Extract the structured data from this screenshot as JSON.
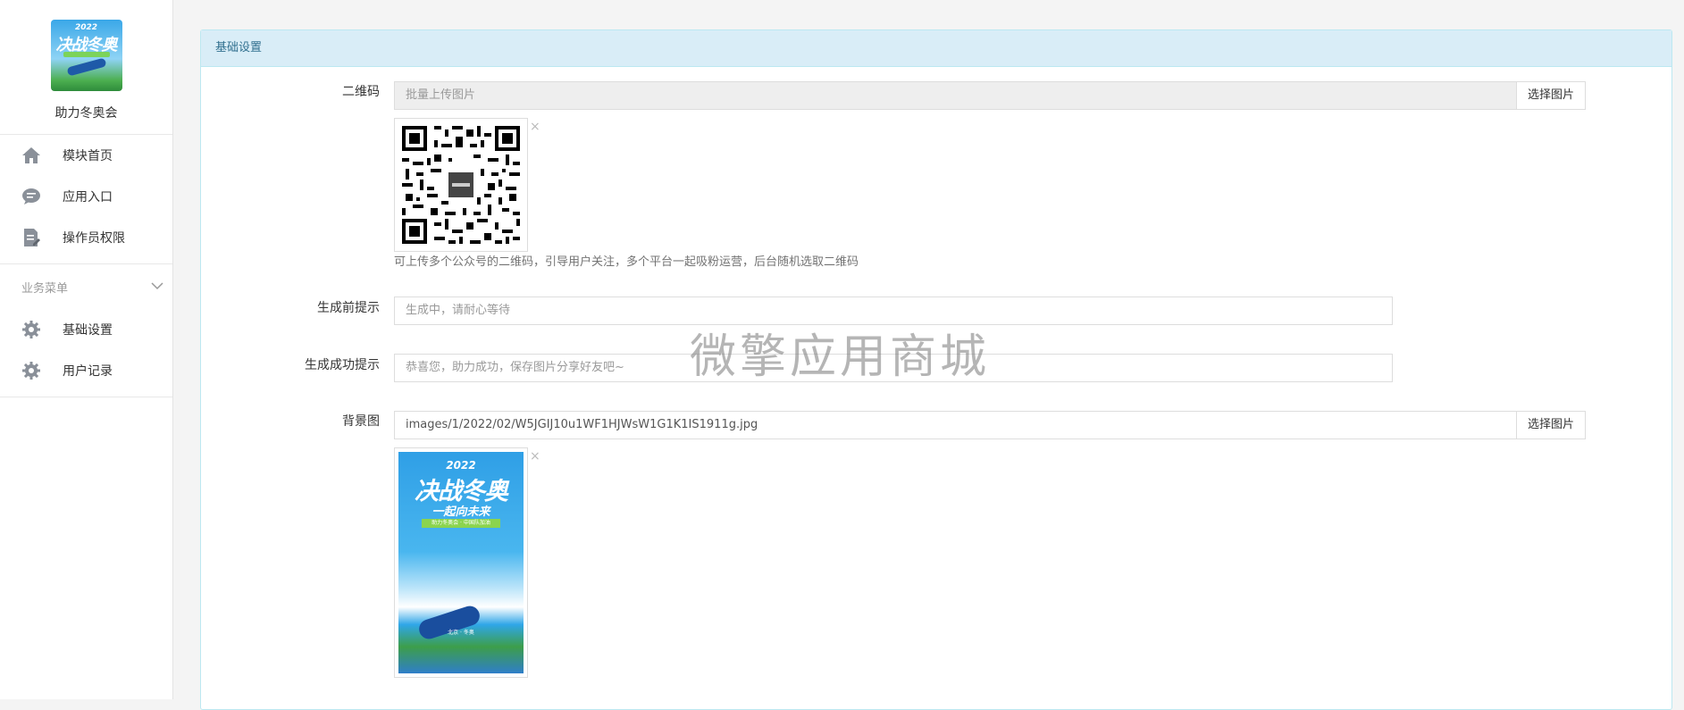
{
  "sidebar": {
    "logo_year": "2022",
    "logo_title": "决战冬奥",
    "app_name": "助力冬奥会",
    "items": [
      {
        "label": "模块首页",
        "icon": "home-icon"
      },
      {
        "label": "应用入口",
        "icon": "chat-bubble-icon"
      },
      {
        "label": "操作员权限",
        "icon": "document-edit-icon"
      }
    ],
    "group": {
      "title": "业务菜单",
      "icon": "chevron-down-icon",
      "items": [
        {
          "label": "基础设置",
          "icon": "gear-icon"
        },
        {
          "label": "用户记录",
          "icon": "gear-icon"
        }
      ]
    }
  },
  "panel": {
    "title": "基础设置",
    "qrcode": {
      "label": "二维码",
      "placeholder": "批量上传图片",
      "button": "选择图片",
      "remove": "×",
      "help": "可上传多个公众号的二维码，引导用户关注，多个平台一起吸粉运营，后台随机选取二维码"
    },
    "before_tip": {
      "label": "生成前提示",
      "placeholder": "生成中，请耐心等待"
    },
    "success_tip": {
      "label": "生成成功提示",
      "placeholder": "恭喜您，助力成功，保存图片分享好友吧~"
    },
    "background": {
      "label": "背景图",
      "value": "images/1/2022/02/W5JGIJ10u1WF1HJWsW1G1K1IS1911g.jpg",
      "button": "选择图片",
      "remove": "×",
      "poster_year": "2022",
      "poster_title": "决战冬奥",
      "poster_subtitle": "一起向未来",
      "poster_banner": "助力冬奥会 · 中国队加油",
      "poster_footer": "北京 · 冬奥"
    }
  },
  "watermark": "微擎应用商城",
  "colors": {
    "panel_header_bg": "#d9edf7",
    "panel_header_text": "#31708f",
    "panel_border": "#bce8f1"
  }
}
